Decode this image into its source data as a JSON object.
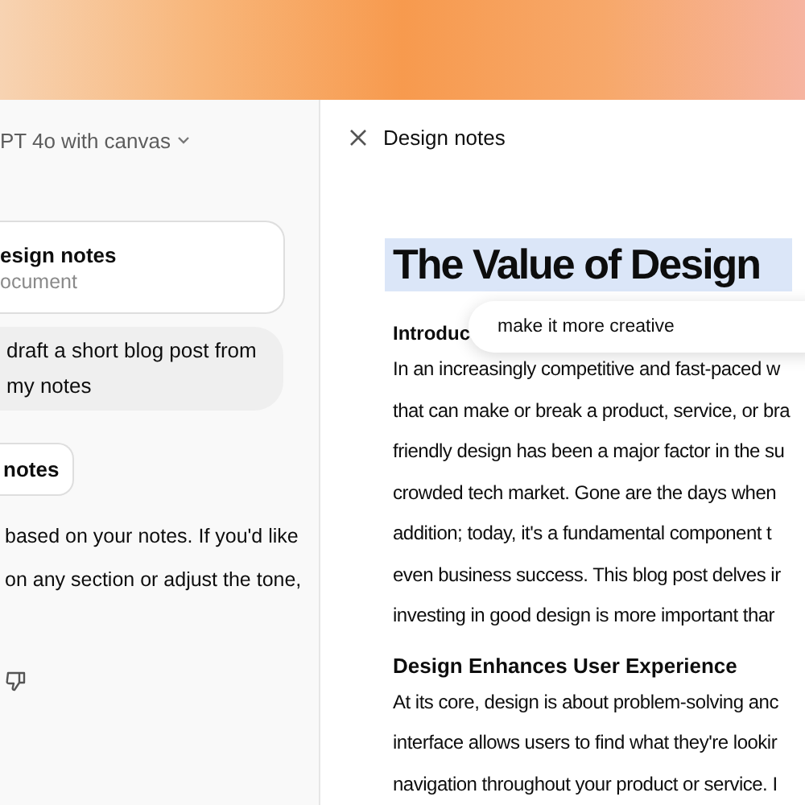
{
  "chat": {
    "model_label": "PT 4o with canvas",
    "document_card": {
      "title": "esign notes",
      "subtitle": "ocument"
    },
    "user_message": "draft a short blog post from my notes",
    "chip": "notes",
    "reply_lines": [
      "based on your notes. If you'd like",
      "on any section or adjust the tone,"
    ]
  },
  "canvas": {
    "title": "Design notes",
    "heading": "The Value of Design",
    "heading_selected": true,
    "edit_prompt": "make it more creative",
    "sections": [
      {
        "heading": "Introduc",
        "lines": [
          "In an increasingly competitive and fast-paced w",
          "that can make or break a product, service, or bra",
          "friendly design has been a major factor in the su",
          "crowded tech market. Gone are the days when",
          "addition; today, it's a fundamental component t",
          "even business success. This blog post delves ir",
          "investing in good design is more important thar"
        ]
      },
      {
        "heading": "Design Enhances User Experience",
        "lines": [
          "At its core, design is about problem-solving anc",
          "interface allows users to find what they're lookir",
          "navigation throughout your product or service. I"
        ]
      }
    ]
  }
}
